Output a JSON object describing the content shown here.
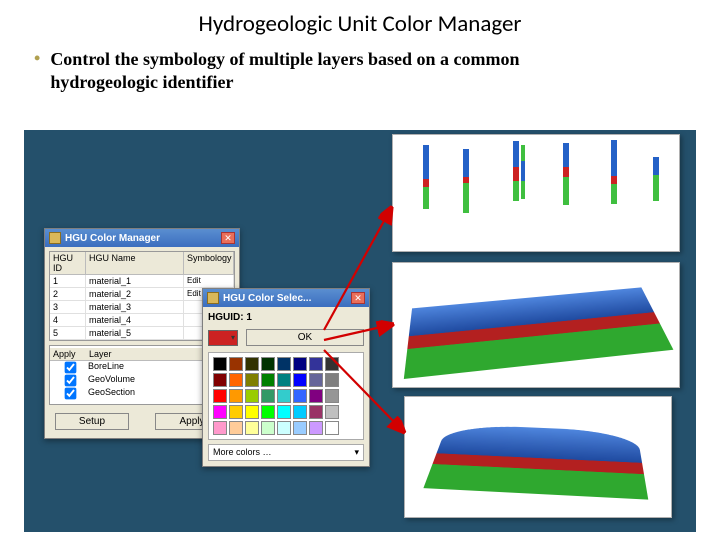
{
  "title": "Hydrogeologic Unit Color Manager",
  "bullet": "Control the symbology of multiple layers based on a common hydrogeologic identifier",
  "mgr": {
    "window_title": "HGU Color Manager",
    "cols": {
      "id": "HGU ID",
      "name": "HGU Name",
      "sym": "Symbology"
    },
    "rows": [
      {
        "id": "1",
        "name": "material_1",
        "action": "Edit"
      },
      {
        "id": "2",
        "name": "material_2",
        "action": "Edit"
      },
      {
        "id": "3",
        "name": "material_3",
        "action": ""
      },
      {
        "id": "4",
        "name": "material_4",
        "action": ""
      },
      {
        "id": "5",
        "name": "material_5",
        "action": ""
      }
    ],
    "layer_cols": {
      "apply": "Apply",
      "layer": "Layer"
    },
    "layers": [
      {
        "checked": true,
        "name": "BoreLine"
      },
      {
        "checked": true,
        "name": "GeoVolume"
      },
      {
        "checked": true,
        "name": "GeoSection"
      }
    ],
    "buttons": {
      "setup": "Setup",
      "apply": "Apply"
    }
  },
  "selector": {
    "window_title": "HGU Color Selec...",
    "label": "HGUID: 1",
    "ok": "OK",
    "more": "More colors …",
    "selected_color": "#cc2222",
    "palette": [
      "#000000",
      "#993300",
      "#333300",
      "#003300",
      "#003366",
      "#000080",
      "#333399",
      "#333333",
      "#800000",
      "#ff6600",
      "#808000",
      "#008000",
      "#008080",
      "#0000ff",
      "#666699",
      "#808080",
      "#ff0000",
      "#ff9900",
      "#99cc00",
      "#339966",
      "#33cccc",
      "#3366ff",
      "#800080",
      "#969696",
      "#ff00ff",
      "#ffcc00",
      "#ffff00",
      "#00ff00",
      "#00ffff",
      "#00ccff",
      "#993366",
      "#c0c0c0",
      "#ff99cc",
      "#ffcc99",
      "#ffff99",
      "#ccffcc",
      "#ccffff",
      "#99ccff",
      "#cc99ff",
      "#ffffff"
    ]
  },
  "colors": {
    "unit_blue": "#2461c7",
    "unit_red": "#cc2222",
    "unit_green": "#3fbf3f",
    "slide_bg": "#24506b"
  }
}
